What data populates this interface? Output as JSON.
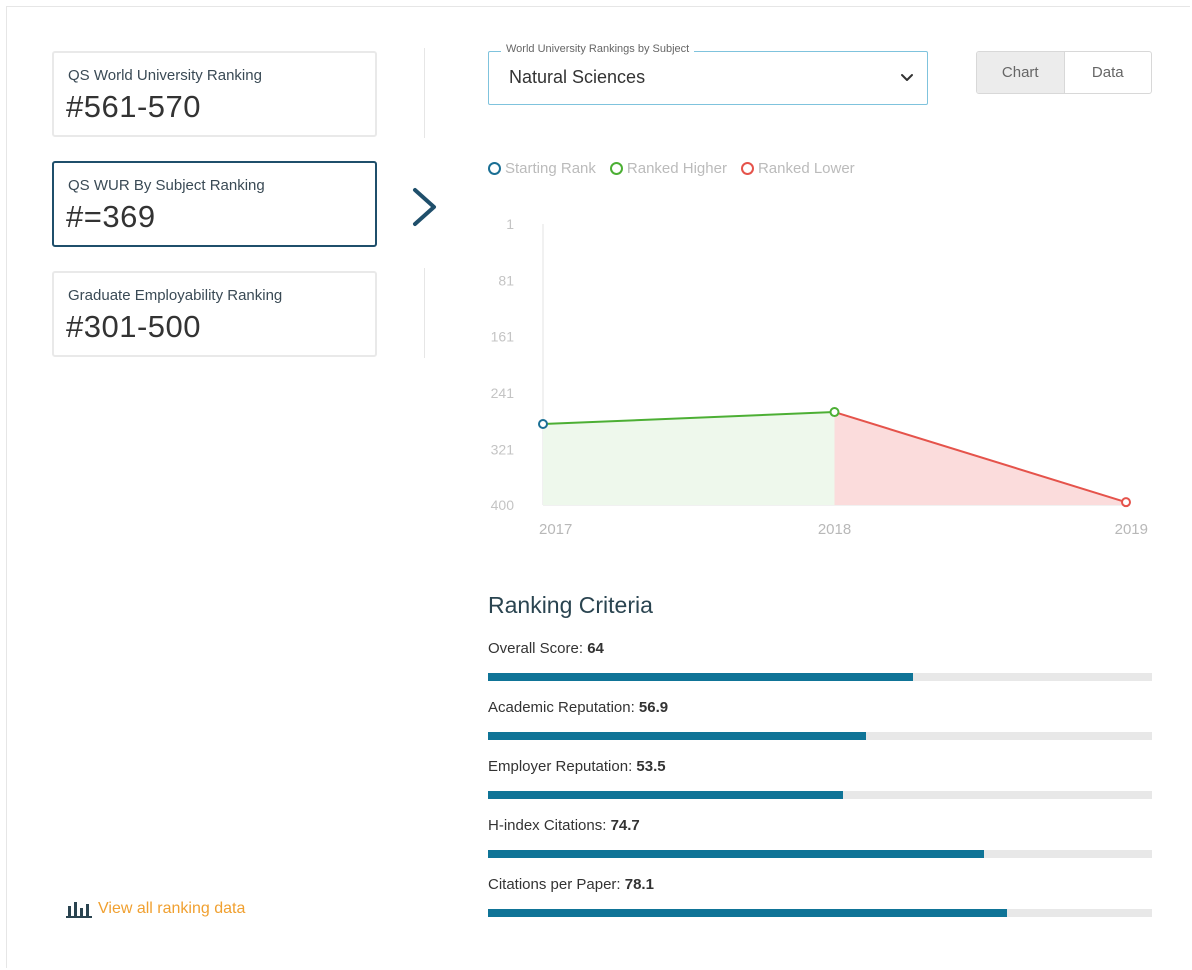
{
  "rankings": [
    {
      "label": "QS World University Ranking",
      "value": "#561-570"
    },
    {
      "label": "QS WUR By Subject Ranking",
      "value": "#=369"
    },
    {
      "label": "Graduate Employability Ranking",
      "value": "#301-500"
    }
  ],
  "selector": {
    "legend": "World University Rankings by Subject",
    "selected": "Natural Sciences"
  },
  "view_toggle": {
    "chart": "Chart",
    "data": "Data",
    "active": "Chart"
  },
  "legend": {
    "starting": "Starting Rank",
    "higher": "Ranked Higher",
    "lower": "Ranked Lower"
  },
  "colors": {
    "starting": "#1a6f94",
    "higher": "#4caf34",
    "lower": "#e5534b",
    "higher_fill": "#eef8ec",
    "lower_fill": "#fbdcdc",
    "bar": "#0f7497",
    "link": "#f0a030"
  },
  "chart_data": {
    "type": "line",
    "x": [
      "2017",
      "2018",
      "2019"
    ],
    "y": [
      285,
      268,
      396
    ],
    "yticks": [
      1,
      81,
      161,
      241,
      321,
      400
    ],
    "ylim": [
      1,
      400
    ],
    "inverted": true
  },
  "criteria": {
    "title": "Ranking Criteria",
    "items": [
      {
        "label": "Overall Score: ",
        "value": "64",
        "score": 64
      },
      {
        "label": "Academic Reputation: ",
        "value": "56.9",
        "score": 56.9
      },
      {
        "label": "Employer Reputation: ",
        "value": "53.5",
        "score": 53.5
      },
      {
        "label": "H-index Citations: ",
        "value": "74.7",
        "score": 74.7
      },
      {
        "label": "Citations per Paper: ",
        "value": "78.1",
        "score": 78.1
      }
    ]
  },
  "view_all": {
    "label": "View all ranking data",
    "icon": "bar-chart-icon"
  }
}
